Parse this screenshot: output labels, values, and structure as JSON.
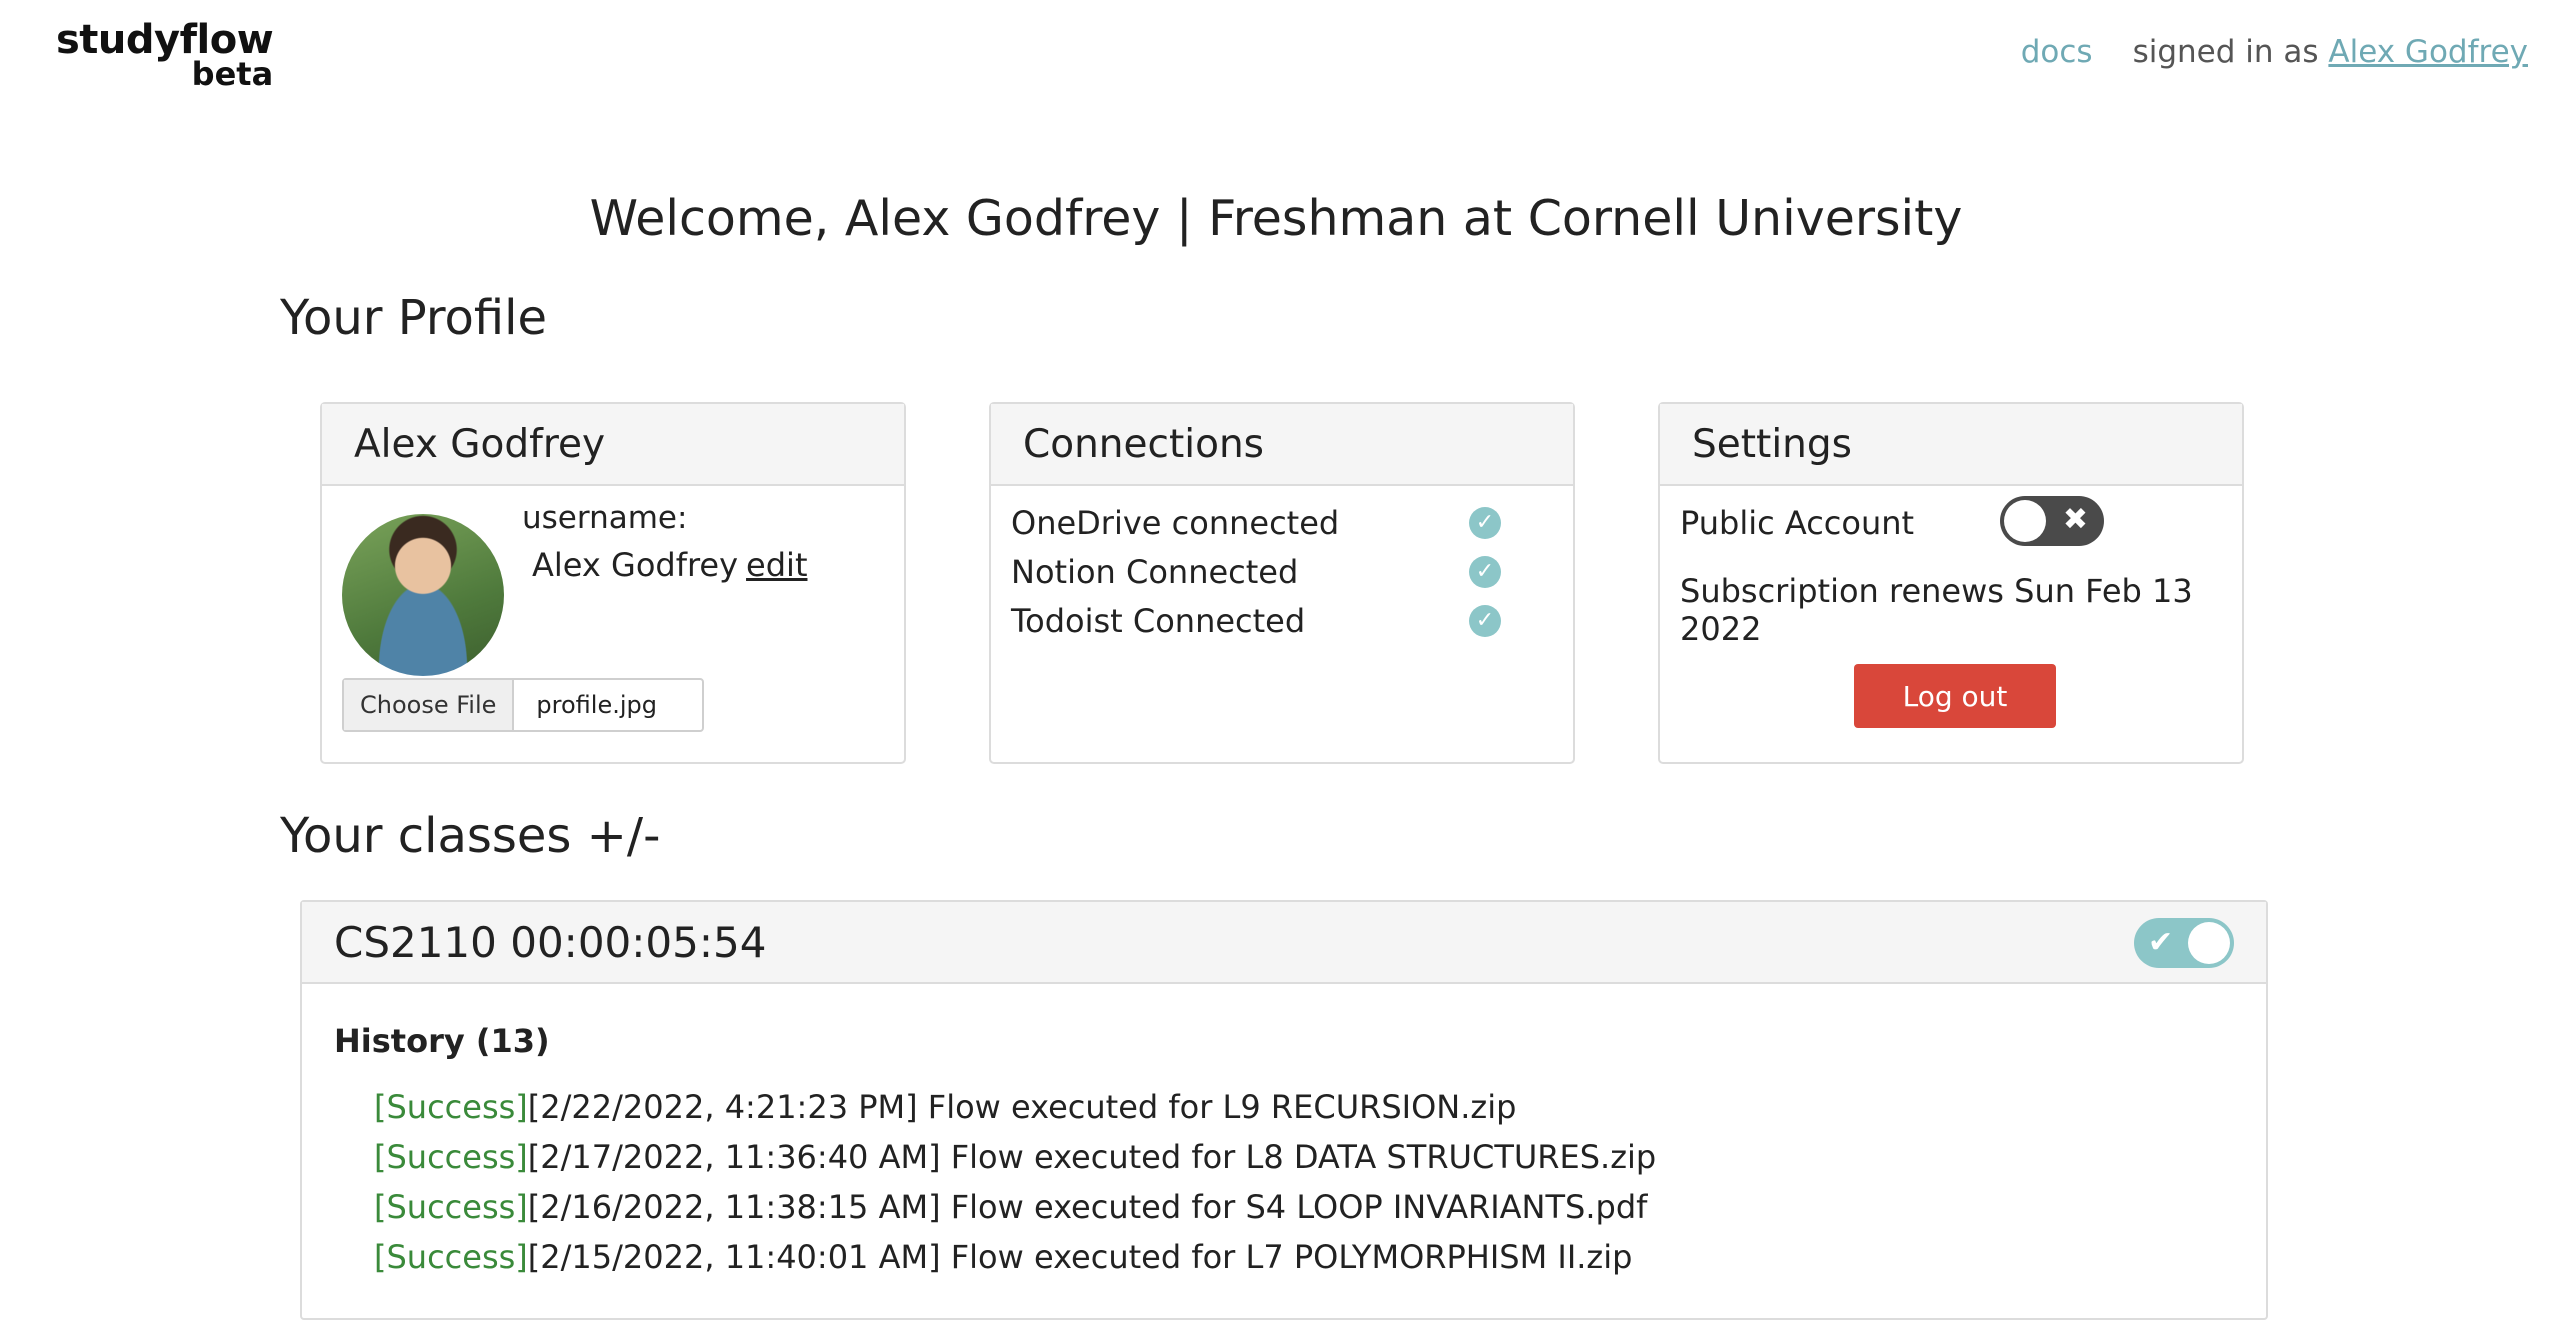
{
  "brand": {
    "name": "studyflow",
    "tag": "beta"
  },
  "topnav": {
    "docs": "docs",
    "signed_in_prefix": "signed in as",
    "user": "Alex Godfrey"
  },
  "welcome": "Welcome, Alex Godfrey | Freshman at Cornell University",
  "profile_section_title": "Your Profile",
  "profile_card": {
    "title": "Alex Godfrey",
    "username_label": "username:",
    "username_value": "Alex Godfrey",
    "edit": "edit",
    "file_button": "Choose File",
    "file_name": "profile.jpg"
  },
  "connections_card": {
    "title": "Connections",
    "items": [
      {
        "label": "OneDrive connected",
        "icon": "check-icon"
      },
      {
        "label": "Notion Connected",
        "icon": "check-icon"
      },
      {
        "label": "Todoist Connected",
        "icon": "check-icon"
      }
    ]
  },
  "settings_card": {
    "title": "Settings",
    "public_account_label": "Public Account",
    "public_account_enabled": false,
    "renewal": "Subscription renews Sun Feb 13 2022",
    "logout": "Log out"
  },
  "classes_section_title": "Your classes +/-",
  "class": {
    "title": "CS2110 00:00:05:54",
    "enabled": true,
    "history_title": "History (13)",
    "history": [
      {
        "status": "[Success]",
        "text": "[2/22/2022, 4:21:23 PM] Flow executed for L9 RECURSION.zip"
      },
      {
        "status": "[Success]",
        "text": "[2/17/2022, 11:36:40 AM] Flow executed for L8 DATA STRUCTURES.zip"
      },
      {
        "status": "[Success]",
        "text": "[2/16/2022, 11:38:15 AM] Flow executed for S4 LOOP INVARIANTS.pdf"
      },
      {
        "status": "[Success]",
        "text": "[2/15/2022, 11:40:01 AM] Flow executed for L7 POLYMORPHISM II.zip"
      }
    ]
  },
  "colors": {
    "accent": "#8cc6c8",
    "link": "#6fa9b4",
    "danger": "#d9473a",
    "success": "#3a8a3a"
  }
}
